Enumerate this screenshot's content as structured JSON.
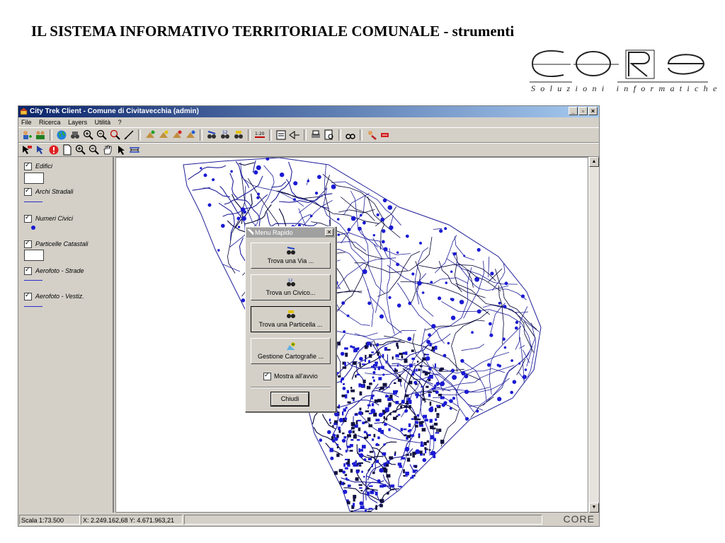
{
  "slide": {
    "title": "IL SISTEMA INFORMATIVO TERRITORIALE COMUNALE - strumenti",
    "logo_text": "CORE",
    "logo_tagline": "Soluzioni informatiche"
  },
  "window": {
    "title": "City Trek Client - Comune di Civitavecchia (admin)",
    "controls": {
      "minimize": "_",
      "maximize": "▫",
      "close": "×"
    }
  },
  "menubar": [
    "File",
    "Ricerca",
    "Layers",
    "Utilità",
    "?"
  ],
  "layers": [
    {
      "name": "Edifici",
      "checked": true,
      "symbol": "box"
    },
    {
      "name": "Archi Stradali",
      "checked": true,
      "symbol": "line"
    },
    {
      "name": "Numeri Civici",
      "checked": true,
      "symbol": "dot"
    },
    {
      "name": "Particelle Catastali",
      "checked": true,
      "symbol": "box"
    },
    {
      "name": "Aerofoto - Strade",
      "checked": true,
      "symbol": "line"
    },
    {
      "name": "Aerofoto - Vestiz.",
      "checked": true,
      "symbol": "line"
    }
  ],
  "colors": {
    "map_features": "#1a1ad2",
    "map_lines": "#1f1f99",
    "titlebar": "#0a246a"
  },
  "dialog": {
    "title": "Menu Rapido",
    "buttons": [
      {
        "label": "Trova una Via ...",
        "icon": "binoculars-icon"
      },
      {
        "label": "Trova un Civico...",
        "icon": "binoculars-number-icon"
      },
      {
        "label": "Trova una Particella ...",
        "icon": "binoculars-parcel-icon"
      },
      {
        "label": "Gestione Cartografie ...",
        "icon": "map-manage-icon"
      }
    ],
    "checkbox_label": "Mostra all'avvio",
    "checkbox_checked": true,
    "close_label": "Chiudi"
  },
  "statusbar": {
    "scale": "Scala 1:73.500",
    "coords": "X: 2.249.162,68  Y: 4.671.963,21",
    "logo": "CORE"
  }
}
